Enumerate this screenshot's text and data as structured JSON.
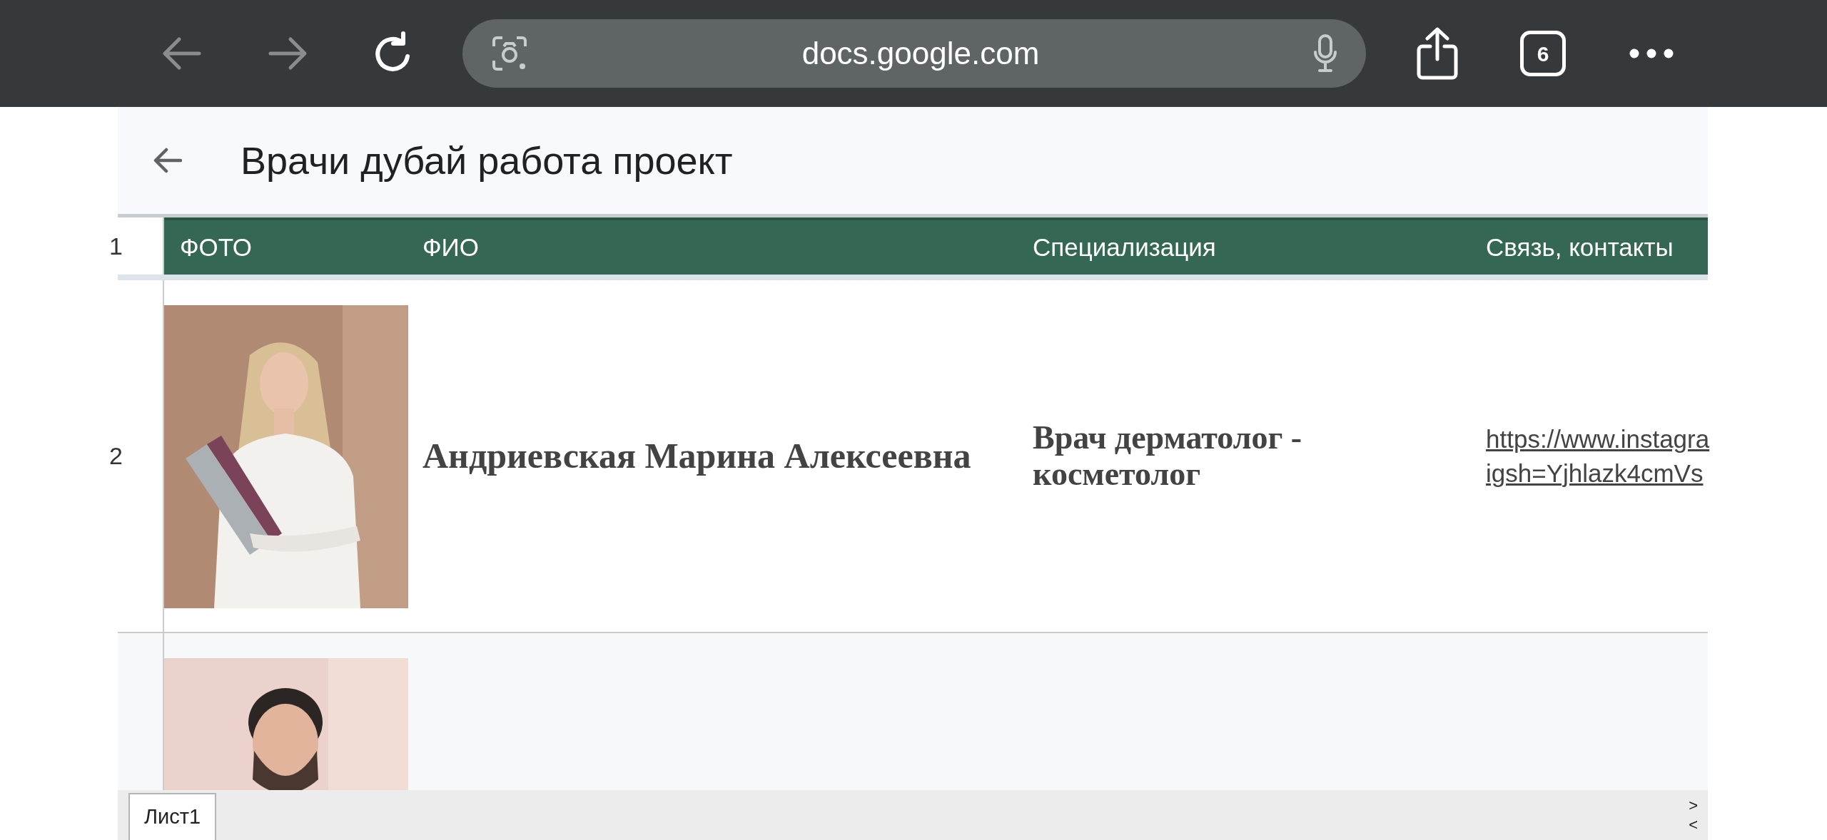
{
  "browser": {
    "nav_buttons": [
      {
        "kind": "back",
        "disabled": true
      },
      {
        "kind": "forward",
        "disabled": true
      },
      {
        "kind": "reload",
        "disabled": false
      }
    ],
    "address": "docs.google.com",
    "tab_count": "6"
  },
  "document": {
    "title": "Врачи дубай работа проект"
  },
  "table": {
    "columns": [
      "ФОТО",
      "ФИО",
      "Специализация",
      "Связь, контакты"
    ],
    "header_row_number": "1",
    "rows": [
      {
        "row_number": "2",
        "photo": {
          "kind": "picture"
        },
        "name": "Андриевская Марина Алексеевна",
        "specialization": "Врач дерматолог - косметолог",
        "contact_lines": [
          "https://www.instagra",
          "igsh=Yjhlazk4cmVs"
        ]
      },
      {
        "photo": {
          "kind": "picture"
        }
      }
    ]
  },
  "sheets": [
    {
      "label": "Лист1",
      "selected": true
    }
  ],
  "sheet_scroll": [
    ">",
    "<"
  ]
}
